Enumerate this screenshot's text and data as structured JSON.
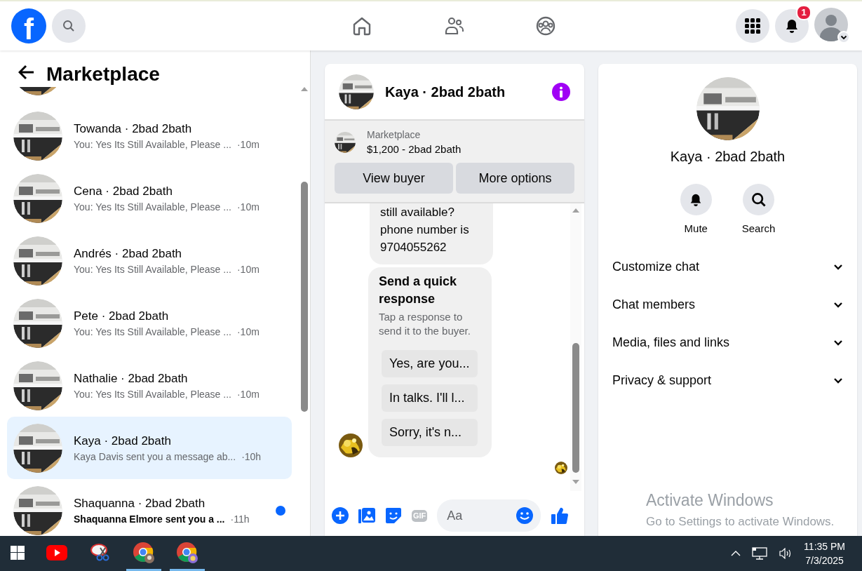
{
  "topbar": {
    "logo_text": "f",
    "notification_count": "1",
    "nav": [
      {
        "kind": "home"
      },
      {
        "kind": "friends"
      },
      {
        "kind": "groups"
      }
    ]
  },
  "sidebar": {
    "title": "Marketplace",
    "conversations": [
      {
        "name": "Towanda · 2bad 2bath",
        "preview": "You: Yes Its Still Available, Please ...",
        "time": "·10m",
        "selected": false,
        "unread": false
      },
      {
        "name": "Cena · 2bad 2bath",
        "preview": "You: Yes Its Still Available, Please ...",
        "time": "·10m",
        "selected": false,
        "unread": false
      },
      {
        "name": "Andrés · 2bad 2bath",
        "preview": "You: Yes Its Still Available, Please ...",
        "time": "·10m",
        "selected": false,
        "unread": false
      },
      {
        "name": "Pete · 2bad 2bath",
        "preview": "You: Yes Its Still Available, Please ...",
        "time": "·10m",
        "selected": false,
        "unread": false
      },
      {
        "name": "Nathalie · 2bad 2bath",
        "preview": "You: Yes Its Still Available, Please ...",
        "time": "·10m",
        "selected": false,
        "unread": false
      },
      {
        "name": "Kaya · 2bad 2bath",
        "preview": "Kaya Davis sent you a message ab...",
        "time": "·10h",
        "selected": true,
        "unread": false
      },
      {
        "name": "Shaquanna · 2bad 2bath",
        "preview": "Shaquanna Elmore sent you a ...",
        "time": "·11h",
        "selected": false,
        "unread": true
      }
    ]
  },
  "chat": {
    "title": "Kaya · 2bad 2bath",
    "listing": {
      "label": "Marketplace",
      "title": "$1,200 - 2bad 2bath",
      "buttons": [
        "View buyer",
        "More options"
      ]
    },
    "message": "still available? phone number is 9704055262",
    "quick_response": {
      "title": "Send a quick response",
      "subtitle": "Tap a response to send it to the buyer.",
      "options": [
        "Yes, are you...",
        "In talks. I'll l...",
        "Sorry, it's n..."
      ]
    },
    "composer": {
      "gif_label": "GIF",
      "placeholder": "Aa"
    }
  },
  "details": {
    "name": "Kaya · 2bad 2bath",
    "actions": [
      "Mute",
      "Search"
    ],
    "sections": [
      {
        "label": "Customize chat",
        "expanded": false
      },
      {
        "label": "Chat members",
        "expanded": false
      },
      {
        "label": "Media, files and links",
        "expanded": false
      },
      {
        "label": "Privacy & support",
        "expanded": false
      }
    ]
  },
  "os_notice": {
    "title": "Activate Windows",
    "text": "Go to Settings to activate Windows."
  },
  "taskbar": {
    "apps": [
      {
        "kind": "youtube",
        "selected": false
      },
      {
        "kind": "snip",
        "selected": false
      },
      {
        "kind": "chrome",
        "selected": true
      },
      {
        "kind": "chrome2",
        "selected": true
      }
    ],
    "time": "11:35 PM",
    "date": "7/3/2025"
  }
}
